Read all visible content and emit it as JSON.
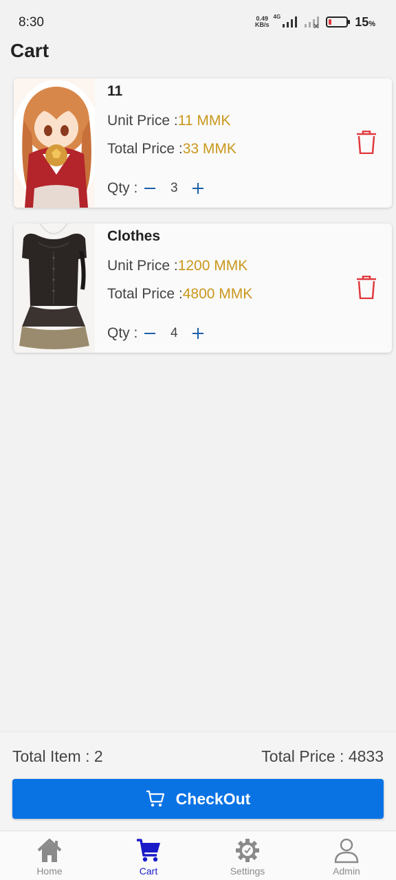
{
  "status_bar": {
    "time": "8:30",
    "net_speed_value": "0.49",
    "net_speed_unit": "KB/s",
    "network_type": "4G",
    "battery_percent": "15",
    "battery_percent_sign": "%"
  },
  "page": {
    "title": "Cart"
  },
  "cart": {
    "items": [
      {
        "name": "11",
        "unit_price_label": "Unit Price :",
        "unit_price_value": "11 MMK",
        "total_price_label": "Total Price :",
        "total_price_value": "33 MMK",
        "qty_label": "Qty :",
        "qty": "3"
      },
      {
        "name": "Clothes",
        "unit_price_label": "Unit Price :",
        "unit_price_value": "1200 MMK",
        "total_price_label": "Total Price :",
        "total_price_value": "4800 MMK",
        "qty_label": "Qty :",
        "qty": "4"
      }
    ]
  },
  "summary": {
    "total_item_text": "Total Item : 2",
    "total_price_text": "Total Price : 4833",
    "checkout_label": "CheckOut"
  },
  "nav": {
    "items": [
      {
        "label": "Home",
        "icon": "home-icon",
        "active": false
      },
      {
        "label": "Cart",
        "icon": "cart-icon",
        "active": true
      },
      {
        "label": "Settings",
        "icon": "gear-icon",
        "active": false
      },
      {
        "label": "Admin",
        "icon": "user-icon",
        "active": false
      }
    ]
  },
  "colors": {
    "accent_blue": "#0a73e4",
    "price_gold": "#c9971c",
    "delete_red": "#e0393e",
    "nav_active": "#1a1ac8",
    "qty_blue": "#1a5fa8"
  }
}
